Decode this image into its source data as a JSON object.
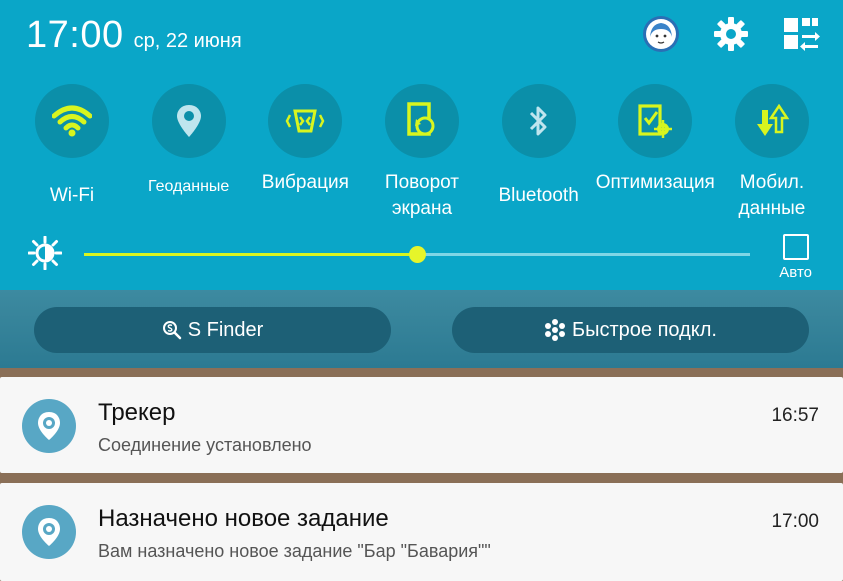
{
  "status_bar": {
    "time": "17:00",
    "date": "ср, 22 июня"
  },
  "header_icons": [
    "avatar-icon",
    "gear-icon",
    "grid-edit-icon"
  ],
  "quick_settings": [
    {
      "label": "Wi-Fi",
      "icon": "wifi-icon",
      "active": true
    },
    {
      "label": "Геоданные",
      "icon": "location-icon",
      "active": false
    },
    {
      "label": "Вибрация",
      "icon": "vibrate-icon",
      "active": true
    },
    {
      "label": "Поворот экрана",
      "icon": "rotate-icon",
      "active": true
    },
    {
      "label": "Bluetooth",
      "icon": "bluetooth-icon",
      "active": false
    },
    {
      "label": "Оптимизация",
      "icon": "optimize-icon",
      "active": true
    },
    {
      "label": "Мобил. данные",
      "icon": "mobile-data-icon",
      "active": true
    }
  ],
  "brightness": {
    "level": 0.5,
    "auto_label": "Авто",
    "auto_checked": false
  },
  "buttons": {
    "s_finder": "S Finder",
    "quick_connect": "Быстрое подкл."
  },
  "notifications": [
    {
      "title": "Трекер",
      "time": "16:57",
      "body": "Соединение установлено"
    },
    {
      "title": "Назначено новое задание",
      "time": "17:00",
      "body": "Вам назначено новое задание \"Бар \"Бавария\"\""
    }
  ],
  "colors": {
    "panel": "#0aa6c8",
    "tile_bg": "#0b8fa9",
    "active": "#d8f51f",
    "inactive": "#bfe5ee",
    "accent_app": "#58a7c5"
  }
}
